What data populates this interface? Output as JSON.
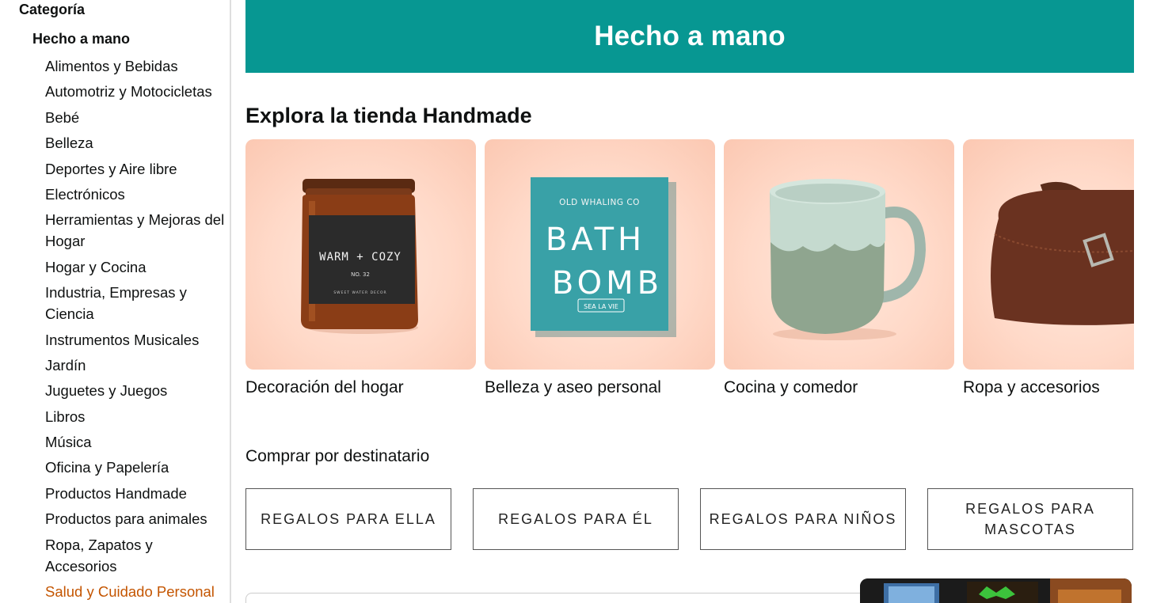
{
  "sidebar": {
    "heading": "Categoría",
    "subheading": "Hecho a mano",
    "items": [
      "Alimentos y Bebidas",
      "Automotriz y Motocicletas",
      "Bebé",
      "Belleza",
      "Deportes y Aire libre",
      "Electrónicos",
      "Herramientas y Mejoras del Hogar",
      "Hogar y Cocina",
      "Industria, Empresas y Ciencia",
      "Instrumentos Musicales",
      "Jardín",
      "Juguetes y Juegos",
      "Libros",
      "Música",
      "Oficina y Papelería",
      "Productos Handmade",
      "Productos para animales",
      "Ropa, Zapatos y Accesorios",
      "Salud y Cuidado Personal"
    ],
    "active_item": "Salud y Cuidado Personal"
  },
  "banner": {
    "title": "Hecho a mano",
    "color": "#079792"
  },
  "explore": {
    "title": "Explora la tienda Handmade",
    "tiles": [
      {
        "label": "Decoración del hogar",
        "image": "candle-jar-icon",
        "jar_label_top": "WARM + COZY",
        "jar_label_mid": "NO. 32",
        "jar_label_bottom": "SWEET WATER DECOR"
      },
      {
        "label": "Belleza y aseo personal",
        "image": "bath-bomb-box-icon",
        "box_brand": "OLD WHALING CO",
        "box_line1": "BATH",
        "box_line2": "BOMB",
        "box_tag": "SEA LA VIE"
      },
      {
        "label": "Cocina y comedor",
        "image": "ceramic-mug-icon"
      },
      {
        "label": "Ropa y accesorios",
        "image": "leather-bag-icon"
      }
    ]
  },
  "recipients": {
    "title": "Comprar por destinatario",
    "buttons": [
      "REGALOS PARA ELLA",
      "REGALOS PARA ÉL",
      "REGALOS PARA NIÑOS",
      "REGALOS PARA MASCOTAS"
    ]
  }
}
